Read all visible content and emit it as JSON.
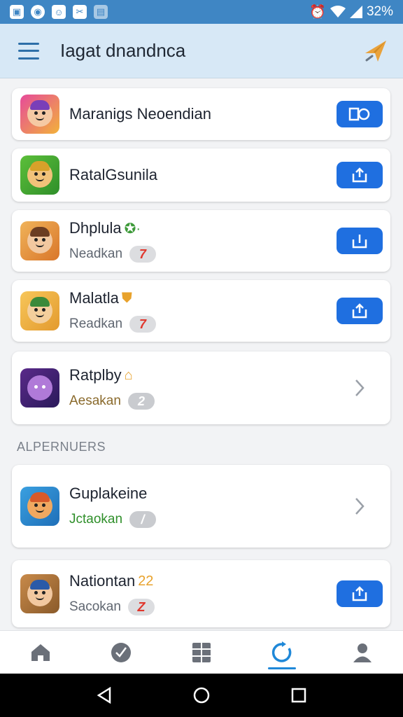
{
  "status_bar": {
    "left_icons": [
      "notification-icon-a",
      "notification-icon-b",
      "notification-icon-c",
      "notification-icon-d",
      "notification-icon-e"
    ],
    "battery_text": "32%"
  },
  "app_bar": {
    "title": "Iagat dnandnca"
  },
  "items": [
    {
      "title": "Maranigs Neoendian",
      "subtitle": "",
      "pill": "",
      "action": "camera-button"
    },
    {
      "title": "RatalGsunila",
      "subtitle": "",
      "pill": "",
      "action": "share-button"
    },
    {
      "title": "Dhplula",
      "subtitle": "Neadkan",
      "pill": "7",
      "action": "share-button"
    },
    {
      "title": "Malatla",
      "subtitle": "Readkan",
      "pill": "7",
      "action": "share-button"
    },
    {
      "title": "Ratplby",
      "subtitle": "Aesakan",
      "pill": "2",
      "action": "chevron"
    }
  ],
  "section": {
    "label": "ALPERNUERS"
  },
  "section_items": [
    {
      "title": "Guplakeine",
      "subtitle": "Jctaokan",
      "pill": "/",
      "action": "chevron"
    },
    {
      "title": "Nationtan",
      "title_badge": "22",
      "subtitle": "Sacokan",
      "pill": "Z",
      "action": "share-button"
    }
  ],
  "bottom_nav": {
    "items": [
      "home",
      "explore",
      "grid",
      "refresh",
      "profile"
    ],
    "active": "refresh"
  },
  "colors": {
    "status_bar": "#3f86c4",
    "app_bar": "#d7e8f6",
    "accent": "#1f6fe0"
  }
}
